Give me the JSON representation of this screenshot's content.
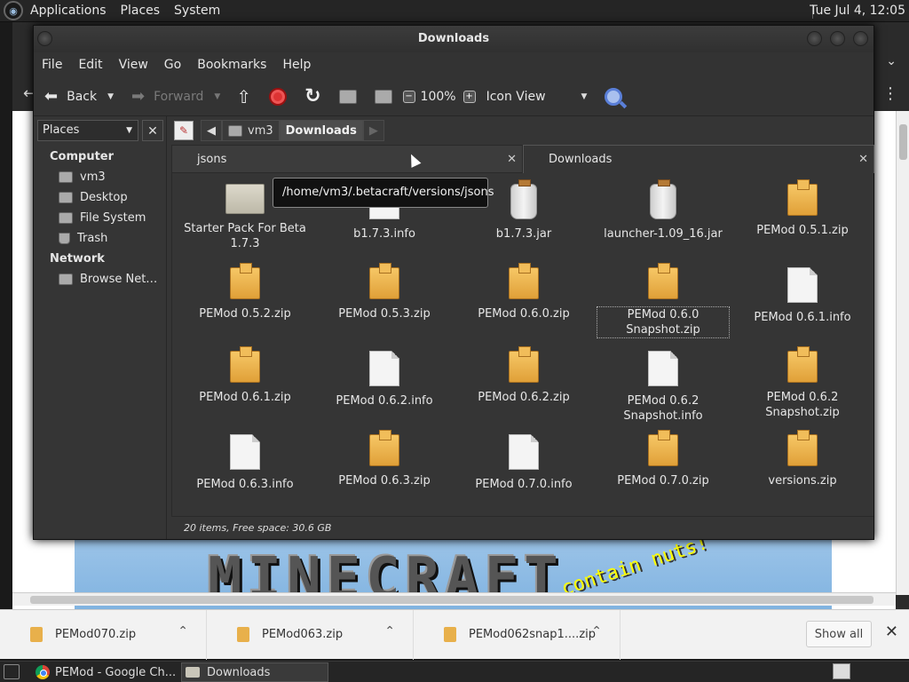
{
  "top_panel": {
    "menus": [
      "Applications",
      "Places",
      "System"
    ],
    "clock": "Tue Jul  4, 12:05"
  },
  "nautilus": {
    "title": "Downloads",
    "menubar": [
      "File",
      "Edit",
      "View",
      "Go",
      "Bookmarks",
      "Help"
    ],
    "toolbar": {
      "back": "Back",
      "forward": "Forward",
      "zoom": "100%",
      "view_mode": "Icon View"
    },
    "sidebar": {
      "combo": "Places",
      "computer_header": "Computer",
      "computer_items": [
        "vm3",
        "Desktop",
        "File System",
        "Trash"
      ],
      "network_header": "Network",
      "network_items": [
        "Browse Net…"
      ]
    },
    "pathbar": {
      "segments": [
        "vm3",
        "Downloads"
      ]
    },
    "tabs": [
      {
        "label": "jsons"
      },
      {
        "label": "Downloads"
      }
    ],
    "tooltip": "/home/vm3/.betacraft/versions/jsons",
    "files": [
      {
        "name": "Starter Pack For Beta 1.7.3",
        "icon": "folder-icon"
      },
      {
        "name": "b1.7.3.info",
        "icon": "document-icon"
      },
      {
        "name": "b1.7.3.jar",
        "icon": "jar-icon"
      },
      {
        "name": "launcher-1.09_16.jar",
        "icon": "jar-icon"
      },
      {
        "name": "PEMod 0.5.1.zip",
        "icon": "zip-icon"
      },
      {
        "name": "PEMod 0.5.2.zip",
        "icon": "zip-icon"
      },
      {
        "name": "PEMod 0.5.3.zip",
        "icon": "zip-icon"
      },
      {
        "name": "PEMod 0.6.0.zip",
        "icon": "zip-icon"
      },
      {
        "name": "PEMod 0.6.0 Snapshot.zip",
        "icon": "zip-icon"
      },
      {
        "name": "PEMod 0.6.1.info",
        "icon": "document-icon"
      },
      {
        "name": "PEMod 0.6.1.zip",
        "icon": "zip-icon"
      },
      {
        "name": "PEMod 0.6.2.info",
        "icon": "document-icon"
      },
      {
        "name": "PEMod 0.6.2.zip",
        "icon": "zip-icon"
      },
      {
        "name": "PEMod 0.6.2 Snapshot.info",
        "icon": "document-icon"
      },
      {
        "name": "PEMod 0.6.2 Snapshot.zip",
        "icon": "zip-icon"
      },
      {
        "name": "PEMod 0.6.3.info",
        "icon": "document-icon"
      },
      {
        "name": "PEMod 0.6.3.zip",
        "icon": "zip-icon"
      },
      {
        "name": "PEMod 0.7.0.info",
        "icon": "document-icon"
      },
      {
        "name": "PEMod 0.7.0.zip",
        "icon": "zip-icon"
      },
      {
        "name": "versions.zip",
        "icon": "zip-icon"
      }
    ],
    "status": "20 items, Free space: 30.6 GB"
  },
  "chrome": {
    "banner_text": "MINECRAFT",
    "splash_text": "contain nuts!",
    "download_bar": {
      "items": [
        "PEMod070.zip",
        "PEMod063.zip",
        "PEMod062snap1....zip"
      ],
      "show_all": "Show all"
    }
  },
  "taskbar": {
    "tasks": [
      "PEMod - Google Ch...",
      "Downloads"
    ]
  }
}
